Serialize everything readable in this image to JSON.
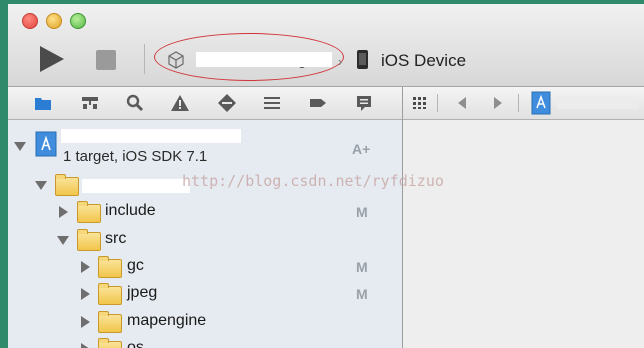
{
  "toolbar": {
    "scheme_visible_suffix": "g",
    "device_label": "iOS Device",
    "scheme_chevron": "›"
  },
  "navigator": {
    "project": {
      "subtitle": "1 target, iOS SDK 7.1",
      "badge": "A+"
    },
    "items": [
      {
        "label": "include",
        "badge": "M"
      },
      {
        "label": "src",
        "badge": ""
      },
      {
        "label": "gc",
        "badge": "M"
      },
      {
        "label": "jpeg",
        "badge": "M"
      },
      {
        "label": "mapengine",
        "badge": ""
      },
      {
        "label": "os",
        "badge": ""
      }
    ]
  },
  "watermark": "http://blog.csdn.net/ryfdizuo",
  "icons": {
    "toolbar": [
      "run-icon",
      "stop-icon",
      "scheme-app-icon",
      "device-icon"
    ],
    "navigator_bar": [
      "project-navigator-icon",
      "symbol-navigator-icon",
      "search-navigator-icon",
      "issue-navigator-icon",
      "test-navigator-icon",
      "debug-navigator-icon",
      "breakpoint-navigator-icon",
      "log-navigator-icon"
    ],
    "editor_bar": [
      "related-items-icon",
      "back-icon",
      "forward-icon",
      "file-icon"
    ]
  },
  "colors": {
    "annotation_ellipse": "#d0373b",
    "navigator_background": "#e6ebf1",
    "folder": "#f0c54a"
  }
}
